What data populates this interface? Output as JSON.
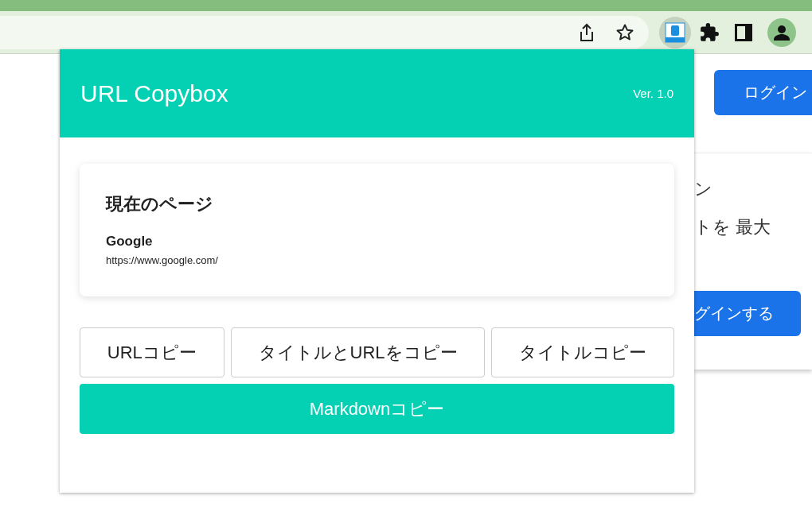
{
  "background_page": {
    "login_button": "ログイン",
    "card_texts": [
      "ン",
      "トを 最大"
    ],
    "card_button": "グインする"
  },
  "popup": {
    "title": "URL Copybox",
    "version": "Ver. 1.0",
    "current_page": {
      "heading": "現在のページ",
      "page_title": "Google",
      "page_url": "https://www.google.com/"
    },
    "buttons": [
      {
        "label": "URLコピー",
        "kind": "outline"
      },
      {
        "label": "タイトルとURLをコピー",
        "kind": "outline"
      },
      {
        "label": "タイトルコピー",
        "kind": "outline"
      },
      {
        "label": "Markdownコピー",
        "kind": "filled"
      }
    ]
  }
}
